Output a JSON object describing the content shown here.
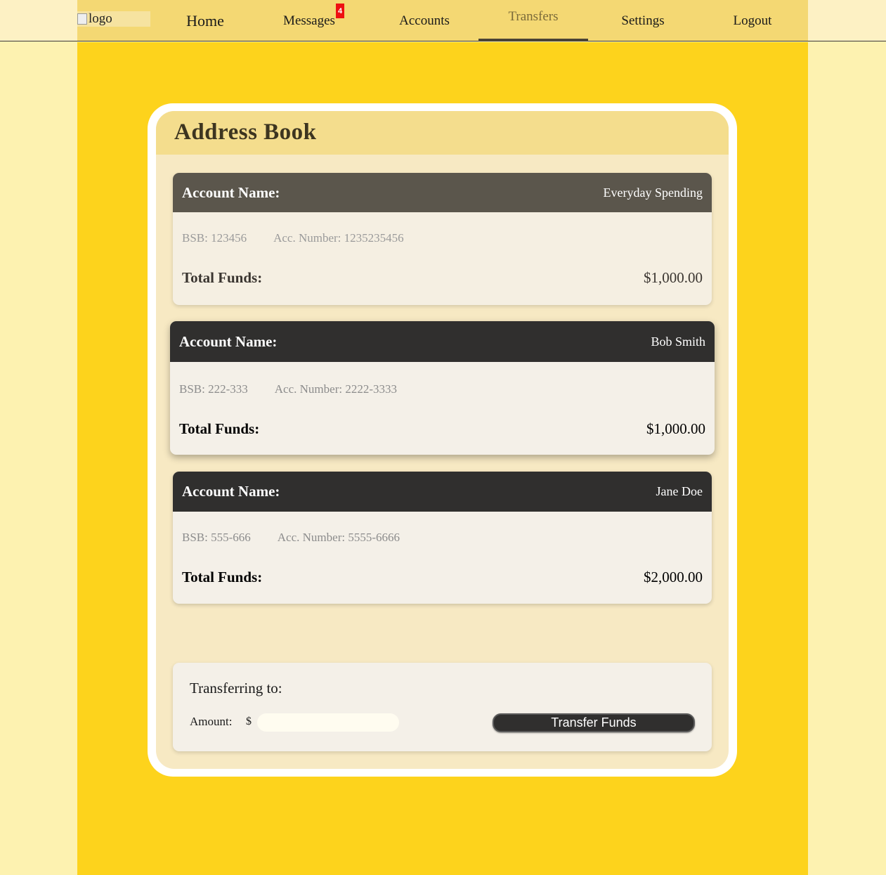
{
  "header": {
    "logo_alt": "logo",
    "nav": {
      "home": "Home",
      "messages": "Messages",
      "messages_badge": "4",
      "accounts": "Accounts",
      "transfers": "Transfers",
      "settings": "Settings",
      "logout": "Logout"
    },
    "active_tab": "Transfers"
  },
  "address_book": {
    "title": "Address Book",
    "accounts": [
      {
        "name_label": "Account Name:",
        "name": "Everyday Spending",
        "bsb": "BSB: 123456",
        "acc_number": "Acc. Number: 1235235456",
        "funds_label": "Total Funds:",
        "funds": "$1,000.00"
      },
      {
        "name_label": "Account Name:",
        "name": "Bob Smith",
        "bsb": "BSB: 222-333",
        "acc_number": "Acc. Number: 2222-3333",
        "funds_label": "Total Funds:",
        "funds": "$1,000.00"
      },
      {
        "name_label": "Account Name:",
        "name": "Jane Doe",
        "bsb": "BSB: 555-666",
        "acc_number": "Acc. Number: 5555-6666",
        "funds_label": "Total Funds:",
        "funds": "$2,000.00"
      }
    ]
  },
  "transfer": {
    "transferring_to": "Transferring to:",
    "amount_label": "Amount:",
    "currency_symbol": "$",
    "amount_value": "",
    "button_label": "Transfer Funds"
  },
  "colors": {
    "page_bg": "#fdf2b0",
    "main_bg": "#fdd31c",
    "nav_bg": "#f4d873",
    "card_header": "#302f2e",
    "card_header_muted": "#5b564c",
    "badge": "#ee1111"
  }
}
